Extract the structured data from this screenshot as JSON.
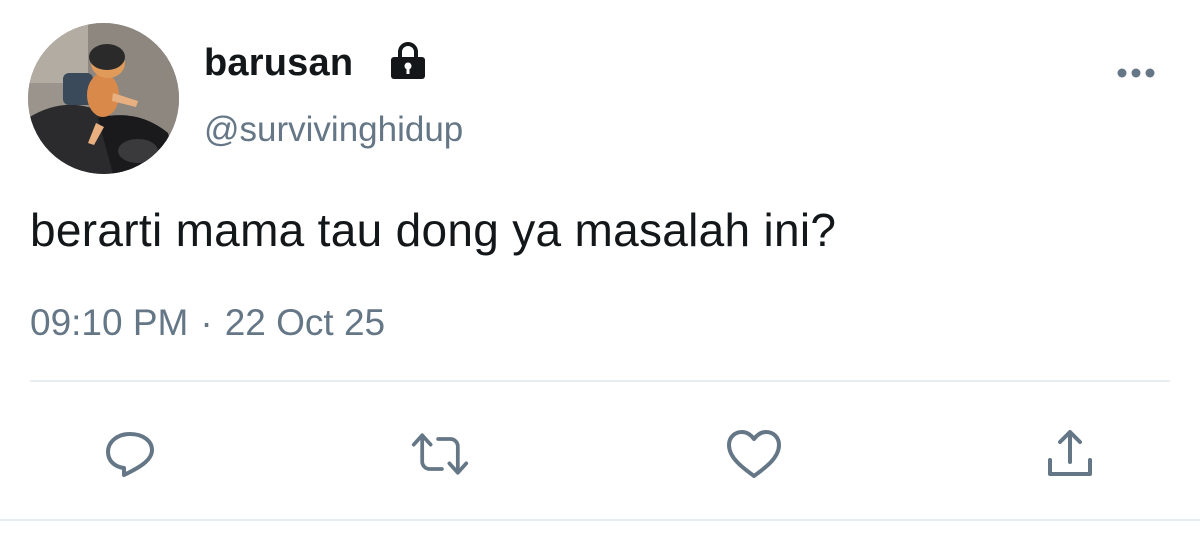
{
  "user": {
    "display_name": "barusan",
    "handle": "@survivinghidup",
    "protected_icon": "lock-icon",
    "avatar_description_icon": "avatar"
  },
  "tweet": {
    "text": "berarti mama tau dong ya masalah ini?",
    "time": "09:10 PM",
    "separator": "·",
    "date": "22 Oct 25"
  },
  "actions": [
    {
      "name": "reply",
      "icon": "reply-icon"
    },
    {
      "name": "retweet",
      "icon": "retweet-icon"
    },
    {
      "name": "like",
      "icon": "heart-icon"
    },
    {
      "name": "share",
      "icon": "share-icon"
    }
  ],
  "colors": {
    "primary_text": "#14171a",
    "secondary_text": "#657786",
    "icon": "#657786",
    "divider": "#e6ecf0"
  }
}
